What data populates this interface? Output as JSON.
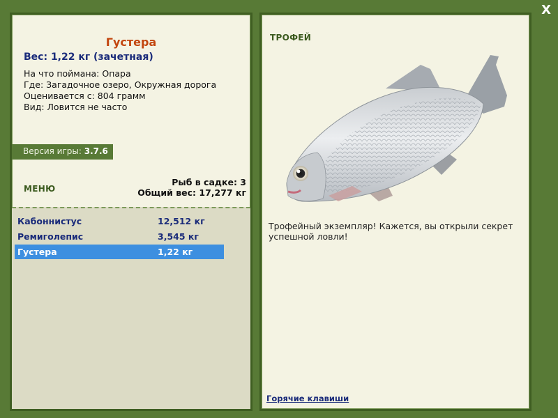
{
  "fish": {
    "title": "Густера",
    "weight": "Вес: 1,22 кг (зачетная)",
    "info": [
      "На что поймана: Опара",
      "Где: Загадочное озеро, Окружная дорога",
      "Оценивается с: 804 грамм",
      "Вид: Ловится не часто"
    ]
  },
  "version": {
    "label": "Версия игры:",
    "value": "3.7.6"
  },
  "menu_label": "МЕНЮ",
  "cage": {
    "count": "Рыб в садке: 3",
    "total": "Общий вес: 17,277 кг"
  },
  "list": [
    {
      "name": "Кабоннистус",
      "weight": "12,512 кг"
    },
    {
      "name": "Ремиголепис",
      "weight": "3,545 кг"
    },
    {
      "name": "Густера",
      "weight": "1,22 кг",
      "selected": true
    }
  ],
  "trophy": {
    "label": "ТРОФЕЙ",
    "text": "Трофейный экземпляр! Кажется, вы открыли секрет успешной ловли!"
  },
  "hotkeys_label": "Горячие клавиши",
  "close_label": "X",
  "colors": {
    "background": "#587a36",
    "panel": "#f4f3e3",
    "list_bg": "#dcdbc5",
    "title": "#c2450e",
    "accent_text": "#1a2b7a",
    "selection": "#3d8fe0"
  },
  "icons": [
    "fish-image",
    "close-icon"
  ]
}
